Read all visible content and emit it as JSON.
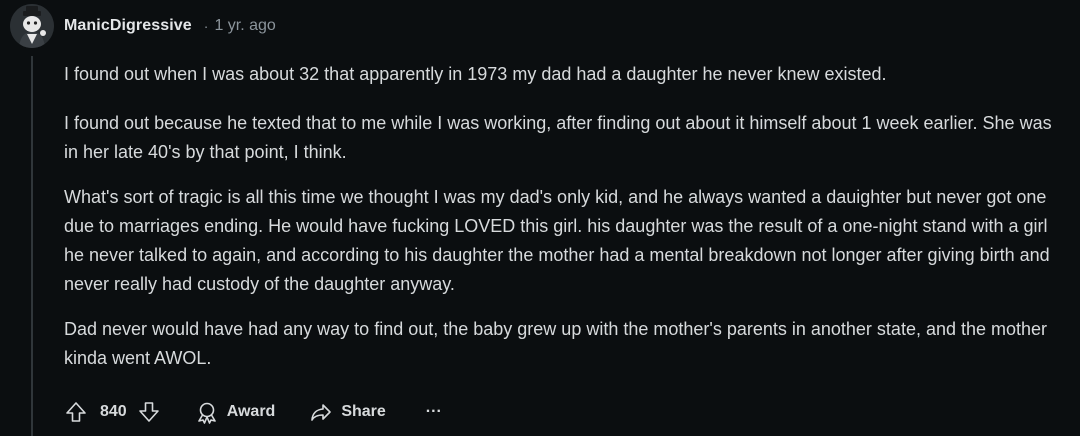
{
  "comment": {
    "username": "ManicDigressive",
    "separator": "·",
    "time": "1 yr. ago",
    "avatar_icon": "user-avatar",
    "paragraphs": [
      "I found out when I was about 32 that apparently in 1973 my dad had a daughter he never knew existed.",
      "I found out because he texted that to me while I was working, after finding out about it himself about 1 week earlier. She was in her late 40's by that point, I think.",
      "What's sort of tragic is all this time we thought I was my dad's only kid, and he always wanted a dauighter but never got one due to marriages ending. He would have fucking LOVED this girl. his daughter was the result of a one-night stand with a girl he never talked to again, and according to his daughter the mother had a mental breakdown not longer after giving birth and never really had custody of the daughter anyway.",
      "Dad never would have had any way to find out, the baby grew up with the mother's parents in another state, and the mother kinda went AWOL."
    ],
    "actions": {
      "score": "840",
      "award_label": "Award",
      "share_label": "Share",
      "more_label": "···"
    }
  },
  "colors": {
    "background": "#0b0e10",
    "text": "#d7dadc",
    "muted": "#8b949b",
    "thread_line": "#30363a"
  }
}
